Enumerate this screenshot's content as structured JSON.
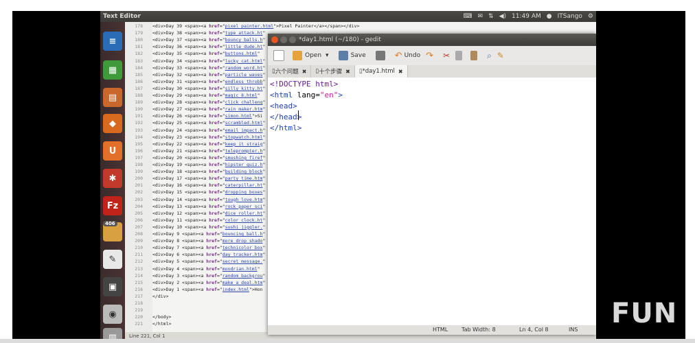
{
  "panel": {
    "app_title": "Text Editor",
    "time": "11:49 AM",
    "user": "ITSango"
  },
  "launcher": {
    "badge_count": "406"
  },
  "background_editor": {
    "lines": [
      {
        "num": "178",
        "day": "39",
        "file": "pixel_painter.html",
        "text": ">Pixel Painter</a></span></div>"
      },
      {
        "num": "179",
        "day": "38",
        "file": "type_attack.ht",
        "text": ""
      },
      {
        "num": "180",
        "day": "37",
        "file": "bouncy_balls.h",
        "text": ""
      },
      {
        "num": "181",
        "day": "36",
        "file": "little_dude.ht",
        "text": ""
      },
      {
        "num": "182",
        "day": "35",
        "file": "buttons.html",
        "text": ""
      },
      {
        "num": "183",
        "day": "34",
        "file": "lucky_cat.html",
        "text": ""
      },
      {
        "num": "184",
        "day": "33",
        "file": "random_word.ht",
        "text": ""
      },
      {
        "num": "185",
        "day": "32",
        "file": "particle_waves",
        "text": ""
      },
      {
        "num": "186",
        "day": "31",
        "file": "endless_throbb",
        "text": ""
      },
      {
        "num": "187",
        "day": "30",
        "file": "silly_kitty.ht",
        "text": ""
      },
      {
        "num": "188",
        "day": "29",
        "file": "magic_8.html",
        "text": ""
      },
      {
        "num": "189",
        "day": "28",
        "file": "click_challeng",
        "text": ""
      },
      {
        "num": "190",
        "day": "27",
        "file": "rain_maker.htm",
        "text": ""
      },
      {
        "num": "191",
        "day": "26",
        "file": "simon.html",
        "text": ">Si"
      },
      {
        "num": "192",
        "day": "25",
        "file": "scrambled.html",
        "text": ""
      },
      {
        "num": "193",
        "day": "24",
        "file": "email_impact.h",
        "text": ""
      },
      {
        "num": "194",
        "day": "23",
        "file": "stopwatch.html",
        "text": ""
      },
      {
        "num": "195",
        "day": "22",
        "file": "keep_it_straig",
        "text": ""
      },
      {
        "num": "196",
        "day": "21",
        "file": "teleprompter.h",
        "text": ""
      },
      {
        "num": "197",
        "day": "20",
        "file": "smushing_firef",
        "text": ""
      },
      {
        "num": "198",
        "day": "19",
        "file": "hipster_quiz.h",
        "text": ""
      },
      {
        "num": "199",
        "day": "18",
        "file": "building_block",
        "text": ""
      },
      {
        "num": "200",
        "day": "17",
        "file": "party_time.htm",
        "text": ""
      },
      {
        "num": "201",
        "day": "16",
        "file": "caterpillar.ht",
        "text": ""
      },
      {
        "num": "202",
        "day": "15",
        "file": "dropping_boxes",
        "text": ""
      },
      {
        "num": "203",
        "day": "14",
        "file": "tough_love.htm",
        "text": ""
      },
      {
        "num": "204",
        "day": "13",
        "file": "rock_paper_sci",
        "text": ""
      },
      {
        "num": "205",
        "day": "12",
        "file": "dice_roller.ht",
        "text": ""
      },
      {
        "num": "206",
        "day": "11",
        "file": "color_clock.ht",
        "text": ""
      },
      {
        "num": "207",
        "day": "10",
        "file": "sushi_jiggler.",
        "text": ""
      },
      {
        "num": "208",
        "day": "9",
        "file": "bouncing_ball.h",
        "text": ""
      },
      {
        "num": "209",
        "day": "8",
        "file": "more_drop_shado",
        "text": ""
      },
      {
        "num": "210",
        "day": "7",
        "file": "technicolor_box",
        "text": ""
      },
      {
        "num": "211",
        "day": "6",
        "file": "day_tracker.htm",
        "text": ""
      },
      {
        "num": "212",
        "day": "5",
        "file": "secret_message.",
        "text": ""
      },
      {
        "num": "213",
        "day": "4",
        "file": "mondrian.html",
        "text": ""
      },
      {
        "num": "214",
        "day": "3",
        "file": "random_backgrou",
        "text": ""
      },
      {
        "num": "215",
        "day": "2",
        "file": "make_a_deal.htm",
        "text": ""
      },
      {
        "num": "216",
        "day": "1",
        "file": "index.html",
        "text": ">Hon"
      }
    ],
    "tail": [
      {
        "num": "217",
        "code": "</div>"
      },
      {
        "num": "218",
        "code": ""
      },
      {
        "num": "219",
        "code": ""
      },
      {
        "num": "220",
        "code": "</body>"
      },
      {
        "num": "221",
        "code": "</html>"
      }
    ],
    "status": "Line 221, Col 1"
  },
  "gedit": {
    "title": "*day1.html (~/180) - gedit",
    "toolbar": {
      "open_label": "Open",
      "save_label": "Save",
      "undo_label": "Undo"
    },
    "tabs": [
      {
        "label": "六个问题",
        "active": false
      },
      {
        "label": "十个步骤",
        "active": false
      },
      {
        "label": "*day1.html",
        "active": true
      }
    ],
    "code_lines": [
      {
        "parts": [
          {
            "cls": "dt",
            "t": "<!DOCTYPE html>"
          }
        ]
      },
      {
        "parts": [
          {
            "cls": "kw",
            "t": "<html"
          },
          {
            "cls": "",
            "t": " lang="
          },
          {
            "cls": "str",
            "t": "\"en\""
          },
          {
            "cls": "kw",
            "t": ">"
          }
        ]
      },
      {
        "parts": [
          {
            "cls": "kw",
            "t": "<head>"
          }
        ]
      },
      {
        "parts": [
          {
            "cls": "kw",
            "t": "</head>"
          }
        ]
      },
      {
        "parts": [
          {
            "cls": "kw",
            "t": "</html>"
          }
        ]
      }
    ],
    "status": {
      "lang": "HTML",
      "tab_width": "Tab Width: 8",
      "position": "Ln 4, Col 8",
      "mode": "INS"
    }
  },
  "watermark": "FUN",
  "colors": {
    "panel_bg": "#3c3b37",
    "close_btn": "#e95420",
    "keyword": "#1f3fb8",
    "string": "#c81e9b"
  }
}
